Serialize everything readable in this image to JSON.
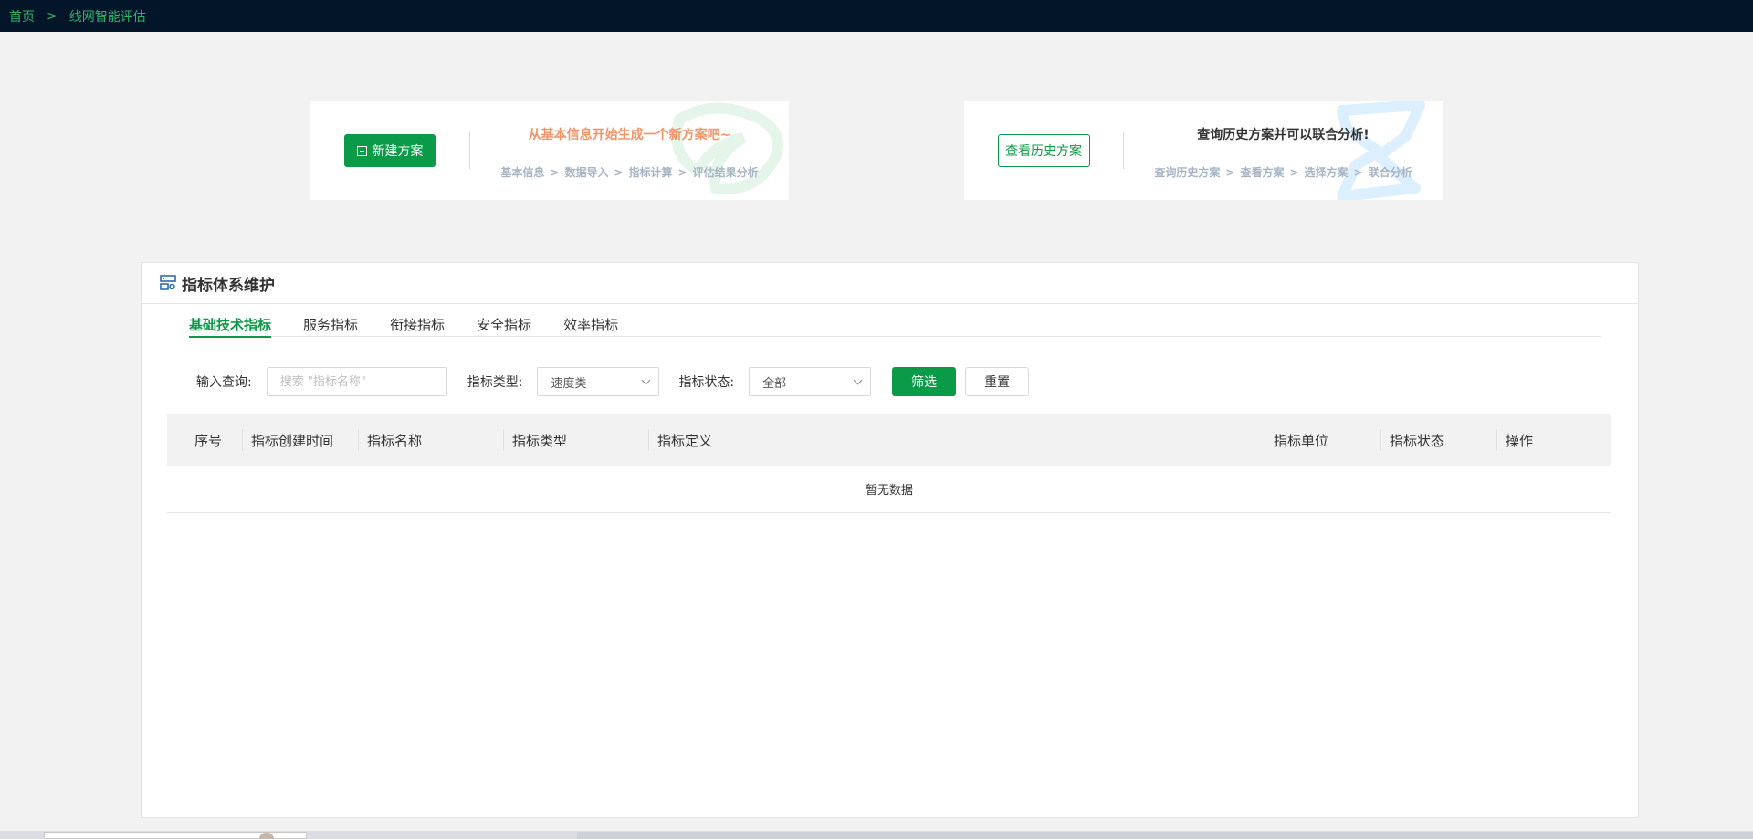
{
  "breadcrumb": {
    "home": "首页",
    "separator": ">",
    "current": "线网智能评估"
  },
  "cards": {
    "new_plan": {
      "button_label": "新建方案",
      "title": "从基本信息开始生成一个新方案吧~",
      "steps": [
        "基本信息",
        "数据导入",
        "指标计算",
        "评估结果分析"
      ]
    },
    "history": {
      "button_label": "查看历史方案",
      "title": "查询历史方案并可以联合分析!",
      "steps": [
        "查询历史方案",
        "查看方案",
        "选择方案",
        "联合分析"
      ]
    },
    "step_separator": ">"
  },
  "panel": {
    "title": "指标体系维护",
    "tabs": [
      {
        "label": "基础技术指标",
        "active": true
      },
      {
        "label": "服务指标",
        "active": false
      },
      {
        "label": "衔接指标",
        "active": false
      },
      {
        "label": "安全指标",
        "active": false
      },
      {
        "label": "效率指标",
        "active": false
      }
    ],
    "filters": {
      "query_label": "输入查询:",
      "query_placeholder": "搜索 \"指标名称\"",
      "type_label": "指标类型:",
      "type_value": "速度类",
      "status_label": "指标状态:",
      "status_value": "全部",
      "filter_button": "筛选",
      "reset_button": "重置"
    },
    "table": {
      "columns": [
        "序号",
        "指标创建时间",
        "指标名称",
        "指标类型",
        "指标定义",
        "指标单位",
        "指标状态",
        "操作"
      ],
      "empty_text": "暂无数据"
    }
  },
  "colors": {
    "accent": "#0b9a47",
    "topbar": "#031529",
    "highlight": "#f39468"
  }
}
